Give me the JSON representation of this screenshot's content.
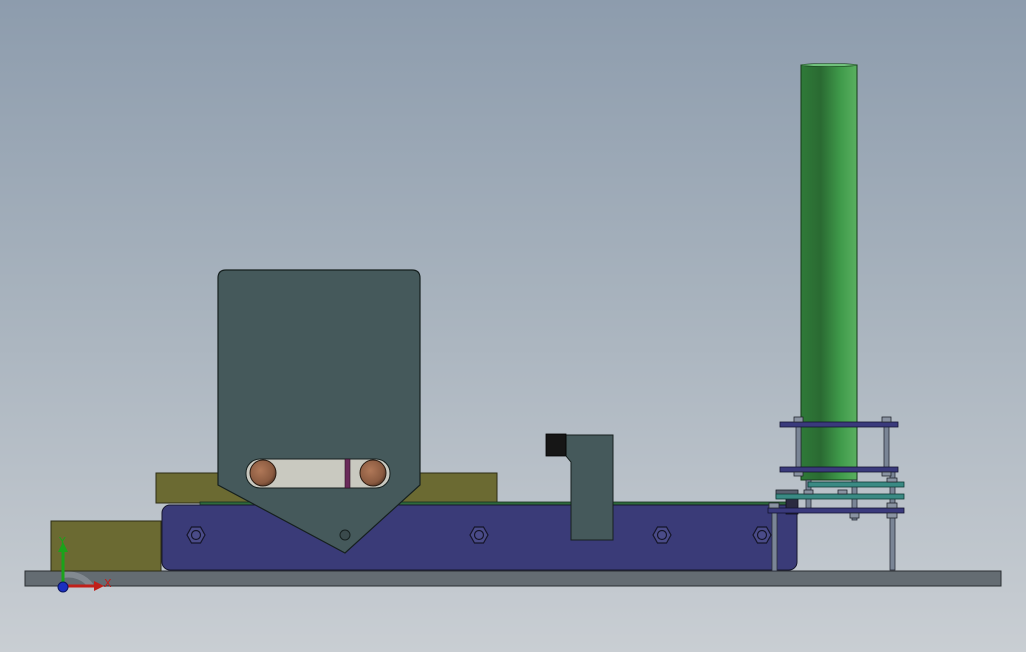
{
  "viewport": {
    "background_top": "#8d9cad",
    "background_bottom": "#c9ced3"
  },
  "triad": {
    "y_label": "Y",
    "x_label": "X",
    "y_color": "#1aa31a",
    "x_color": "#c0201a",
    "z_color": "#1a2fbf"
  },
  "colors": {
    "base_plate": "#646c72",
    "conveyor_body": "#3a3b78",
    "olive_block": "#6b6a32",
    "guard_plate": "#45595b",
    "roller": "#8a5a40",
    "green_tube": "#3a8d45",
    "belt_green": "#2f6a3c",
    "standoff": "#6e7a8c",
    "purple_plate": "#3a3a7c",
    "teal_plate": "#3a8a84"
  }
}
